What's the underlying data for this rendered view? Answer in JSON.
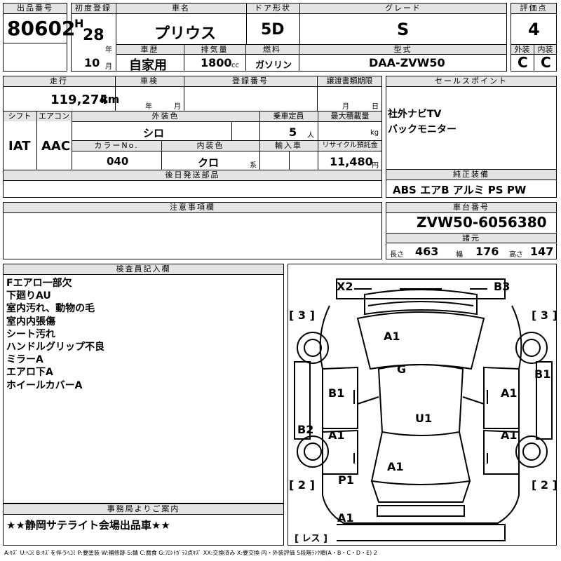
{
  "headers": {
    "lot_number": "出品番号",
    "first_registration": "初度登録",
    "car_name": "車名",
    "door_type": "ドア形状",
    "grade": "グレード",
    "score": "評価点",
    "history": "車歴",
    "displacement": "排気量",
    "fuel": "燃料",
    "model_code": "型式",
    "exterior": "外装",
    "interior": "内装",
    "mileage": "走行",
    "inspection": "車検",
    "registration_number": "登録番号",
    "transfer_docs": "譲渡書類期限",
    "sales_points": "セールスポイント",
    "shift": "シフト",
    "aircon": "エアコン",
    "exterior_color": "外装色",
    "seating": "乗車定員",
    "max_load": "最大積載量",
    "color_no": "カラーNo.",
    "interior_color": "内装色",
    "import": "輸入車",
    "recycle_fee": "リサイクル預託金",
    "later_parts": "後日発送部品",
    "factory_equipment": "純正装備",
    "notes": "注意事項欄",
    "chassis_number": "車台番号",
    "specs": "諸元",
    "inspector": "検査員記入欄",
    "office_notice": "事務局よりご案内"
  },
  "vehicle": {
    "lot_number": "80602",
    "era": "H",
    "year": "28",
    "year_unit": "年",
    "month": "10",
    "month_unit": "月",
    "car_name": "プリウス",
    "door": "5D",
    "grade": "S",
    "score": "4",
    "history": "自家用",
    "displacement": "1800",
    "displacement_unit": "cc",
    "fuel": "ガソリン",
    "model_code": "DAA-ZVW50",
    "exterior_grade": "C",
    "interior_grade": "C",
    "mileage": "119,274",
    "mileage_unit": "km",
    "inspection_year_unit": "年",
    "inspection_month_unit": "月",
    "transfer_month_unit": "月",
    "transfer_day_unit": "日",
    "shift": "IAT",
    "aircon": "AAC",
    "exterior_color": "シロ",
    "seating": "5",
    "seating_unit": "人",
    "max_load_unit": "kg",
    "color_no": "040",
    "interior_color": "クロ",
    "interior_color_suffix": "系",
    "recycle_fee": "11,480",
    "recycle_unit": "円",
    "chassis_number": "ZVW50-6056380",
    "length_label": "長さ",
    "length": "463",
    "width_label": "幅",
    "width": "176",
    "height_label": "高さ",
    "height": "147"
  },
  "sales_points": [
    "社外ナビTV",
    "バックモニター"
  ],
  "factory_equipment": "ABS エアB アルミ PS PW",
  "inspector_notes": [
    "Fエアロ一部欠",
    "下廻りAU",
    "室内汚れ、動物の毛",
    "室内内張傷",
    "シート汚れ",
    "ハンドルグリップ不良",
    "ミラーA",
    "エアロ下A",
    "ホイールカバーA"
  ],
  "office_notice": "★★静岡サテライト会場出品車★★",
  "diagram": {
    "labels": [
      "X2",
      "B3",
      "[ 3 ]",
      "[ 3 ]",
      "A1",
      "G",
      "B1",
      "B1",
      "A1",
      "U1",
      "B2",
      "A1",
      "A1",
      "A1",
      "P1",
      "[ 2 ]",
      "[ 2 ]",
      "A1",
      "[ レス ]"
    ]
  },
  "legend": "A:ｷｽﾞ U:ﾍｺﾐ B:ｷｽﾞを伴うﾍｺﾐ P:要塗装 W:補修跡 S:錆 C:腐食 G:ﾌﾛﾝﾄｶﾞﾗｽ点ｷｽﾞ XX:交換済み X:要交換 内・外装評価 5段階ﾗﾝｸ順(A・B・C・D・E) 2"
}
